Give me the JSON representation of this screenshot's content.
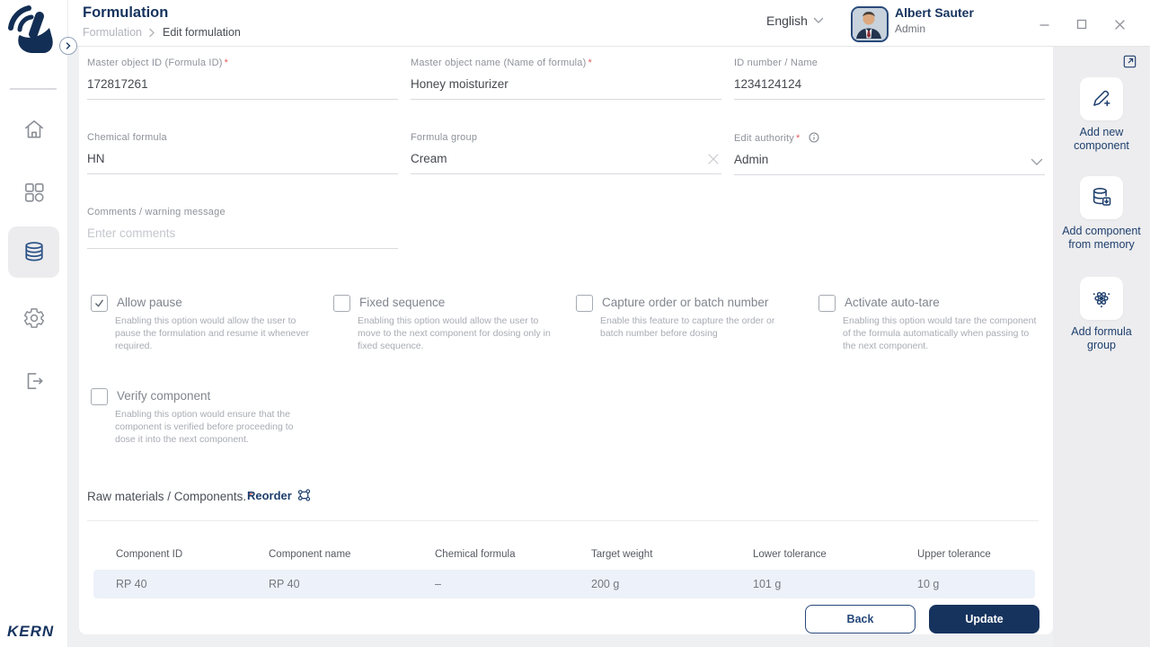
{
  "brand": {
    "name": "KERN",
    "navy": "#16335e",
    "accent_red": "#e25d5d"
  },
  "header": {
    "title": "Formulation",
    "breadcrumb": {
      "parent": "Formulation",
      "current": "Edit formulation"
    },
    "language": "English",
    "user": {
      "name": "Albert Sauter",
      "role": "Admin"
    }
  },
  "form": {
    "required_mark": "*",
    "master_object_id": {
      "label": "Master object ID (Formula ID)",
      "value": "172817261"
    },
    "master_object_name": {
      "label": "Master object name (Name of formula)",
      "value": "Honey moisturizer"
    },
    "id_number": {
      "label": "ID number / Name",
      "value": "1234124124"
    },
    "chemical_formula": {
      "label": "Chemical formula",
      "value": "HN"
    },
    "formula_group": {
      "label": "Formula group",
      "value": "Cream"
    },
    "edit_authority": {
      "label": "Edit authority",
      "value": "Admin"
    },
    "comments": {
      "label": "Comments / warning message",
      "placeholder": "Enter comments"
    },
    "checkboxes": [
      {
        "label": "Allow pause",
        "checked": true,
        "description": "Enabling this option would allow the user to pause the formulation and resume it whenever required."
      },
      {
        "label": "Fixed sequence",
        "checked": false,
        "description": "Enabling this option would allow the user to move to the next component for dosing only in fixed sequence."
      },
      {
        "label": "Capture order or batch number",
        "checked": false,
        "description": "Enable this feature to capture the order or batch number before dosing"
      },
      {
        "label": "Activate auto-tare",
        "checked": false,
        "description": "Enabling this option would tare the component of the formula automatically when passing to the next component."
      },
      {
        "label": "Verify component",
        "checked": false,
        "description": "Enabling this option would ensure that the component is verified before proceeding to dose it into the next component."
      }
    ]
  },
  "components": {
    "section_title": "Raw materials / Components.",
    "reorder_label": "Reorder",
    "table": {
      "headers": [
        "Component ID",
        "Component name",
        "Chemical formula",
        "Target weight",
        "Lower tolerance",
        "Upper tolerance"
      ],
      "rows": [
        {
          "component_id": "RP 40",
          "component_name": "RP 40",
          "chemical_formula": "–",
          "target_weight": "200 g",
          "lower_tolerance": "101 g",
          "upper_tolerance": "10 g"
        }
      ]
    }
  },
  "right_panel": {
    "actions": [
      {
        "icon": "pencil-plus-icon",
        "label": "Add new component"
      },
      {
        "icon": "database-import-icon",
        "label": "Add component from memory"
      },
      {
        "icon": "molecule-icon",
        "label": "Add formula group"
      }
    ]
  },
  "footer": {
    "back_label": "Back",
    "update_label": "Update"
  }
}
